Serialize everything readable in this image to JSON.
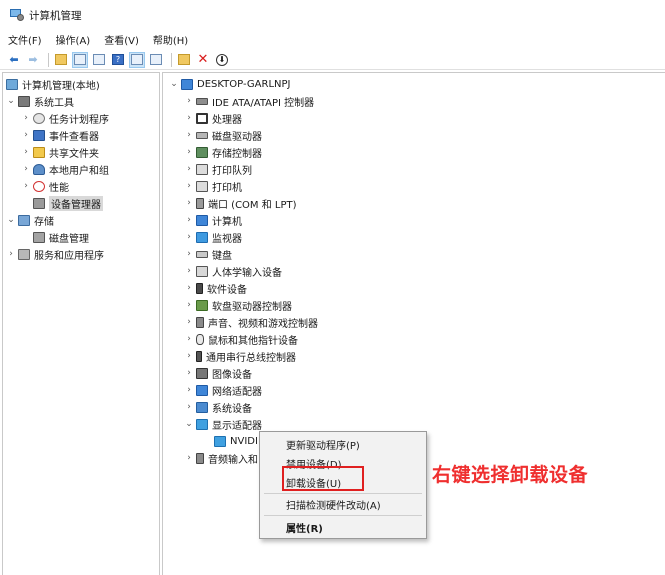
{
  "window": {
    "title": "计算机管理"
  },
  "menu": [
    "文件(F)",
    "操作(A)",
    "查看(V)",
    "帮助(H)"
  ],
  "toolbar_icons": [
    "back-arrow-icon",
    "forward-arrow-icon",
    "up-folder-icon",
    "show-hide-tree-icon",
    "properties-icon",
    "help-icon",
    "view-icon",
    "scan-hardware-icon",
    "uninstall-x-icon",
    "update-driver-icon"
  ],
  "left_tree": [
    {
      "label": "计算机管理(本地)",
      "icon": "computer-management-icon",
      "expand": ""
    },
    {
      "label": "系统工具",
      "icon": "tools-icon",
      "expand": "v"
    },
    {
      "label": "任务计划程序",
      "icon": "clock-icon",
      "expand": ">"
    },
    {
      "label": "事件查看器",
      "icon": "event-viewer-icon",
      "expand": ">"
    },
    {
      "label": "共享文件夹",
      "icon": "shared-folder-icon",
      "expand": ">"
    },
    {
      "label": "本地用户和组",
      "icon": "users-icon",
      "expand": ">"
    },
    {
      "label": "性能",
      "icon": "performance-icon",
      "expand": ">"
    },
    {
      "label": "设备管理器",
      "icon": "device-manager-icon",
      "expand": "",
      "selected": true
    },
    {
      "label": "存储",
      "icon": "storage-icon",
      "expand": "v"
    },
    {
      "label": "磁盘管理",
      "icon": "disk-management-icon",
      "expand": ""
    },
    {
      "label": "服务和应用程序",
      "icon": "services-icon",
      "expand": ">"
    }
  ],
  "device_tree": {
    "root": "DESKTOP-GARLNPJ",
    "categories": [
      "IDE ATA/ATAPI 控制器",
      "处理器",
      "磁盘驱动器",
      "存储控制器",
      "打印队列",
      "打印机",
      "端口 (COM 和 LPT)",
      "计算机",
      "监视器",
      "键盘",
      "人体学输入设备",
      "软件设备",
      "软盘驱动器控制器",
      "声音、视频和游戏控制器",
      "鼠标和其他指针设备",
      "通用串行总线控制器",
      "图像设备",
      "网络适配器",
      "系统设备",
      "显示适配器"
    ],
    "expanded_child": "NVIDI",
    "after": "音频输入和"
  },
  "context_menu": {
    "items": [
      "更新驱动程序(P)",
      "禁用设备(D)",
      "卸载设备(U)",
      "扫描检测硬件改动(A)",
      "属性(R)"
    ],
    "highlighted": "卸载设备(U)"
  },
  "annotation": "右键选择卸载设备",
  "colors": {
    "annotation": "#ef2f2f",
    "highlight_box": "#e02020"
  }
}
